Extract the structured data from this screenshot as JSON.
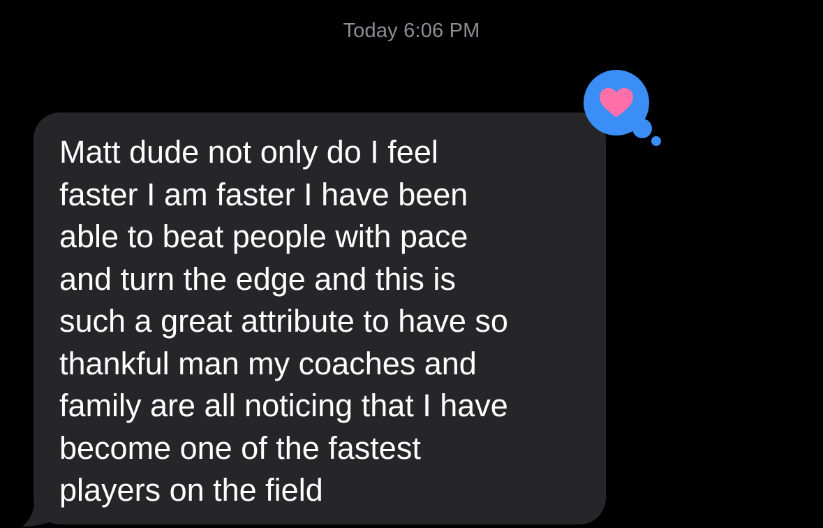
{
  "conversation": {
    "timestamp": "Today 6:06 PM",
    "message": {
      "direction": "incoming",
      "lines": [
        "Matt dude not only do I feel",
        "faster I am faster I have been",
        "able to beat people with pace",
        "and turn the edge and this is",
        "such a great attribute to have so",
        "thankful man my coaches and",
        "family are all noticing that I have",
        "become one of the fastest",
        "players on the field"
      ],
      "bubble_color": "#262628",
      "text_color": "#FFFFFF"
    },
    "tapback": {
      "icon": "heart-icon",
      "bubble_color": "#3A8EF6",
      "heart_color": "#FF6FA8"
    }
  }
}
